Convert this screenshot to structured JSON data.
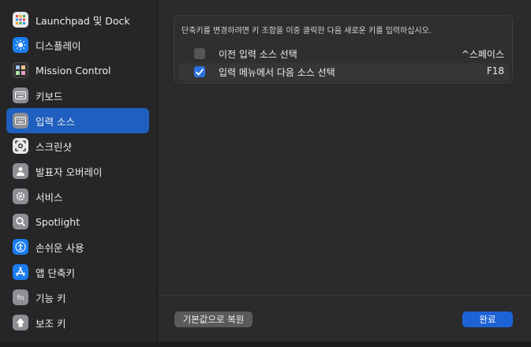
{
  "sidebar": {
    "items": [
      {
        "label": "Launchpad 및 Dock",
        "icon": "launchpad-icon"
      },
      {
        "label": "디스플레이",
        "icon": "display-icon"
      },
      {
        "label": "Mission Control",
        "icon": "mission-control-icon"
      },
      {
        "label": "키보드",
        "icon": "keyboard-icon"
      },
      {
        "label": "입력 소스",
        "icon": "input-sources-icon",
        "selected": true
      },
      {
        "label": "스크린샷",
        "icon": "screenshot-icon"
      },
      {
        "label": "발표자 오버레이",
        "icon": "presenter-overlay-icon"
      },
      {
        "label": "서비스",
        "icon": "services-icon"
      },
      {
        "label": "Spotlight",
        "icon": "spotlight-icon"
      },
      {
        "label": "손쉬운 사용",
        "icon": "accessibility-icon"
      },
      {
        "label": "앱 단축키",
        "icon": "app-shortcuts-icon"
      },
      {
        "label": "기능 키",
        "icon": "function-keys-icon"
      },
      {
        "label": "보조 키",
        "icon": "modifier-keys-icon"
      }
    ]
  },
  "panel": {
    "note": "단축키를 변경하려면 키 조합을 이중 클릭한 다음 새로운 키를 입력하십시오.",
    "rows": [
      {
        "label": "이전 입력 소스 선택",
        "key": "^스페이스",
        "checked": false
      },
      {
        "label": "입력 메뉴에서 다음 소스 선택",
        "key": "F18",
        "checked": true
      }
    ]
  },
  "footer": {
    "restore_label": "기본값으로 복원",
    "done_label": "완료"
  },
  "colors": {
    "accent": "#1f5fbf",
    "button_primary": "#1e63d6",
    "background": "#2b2b2d"
  }
}
